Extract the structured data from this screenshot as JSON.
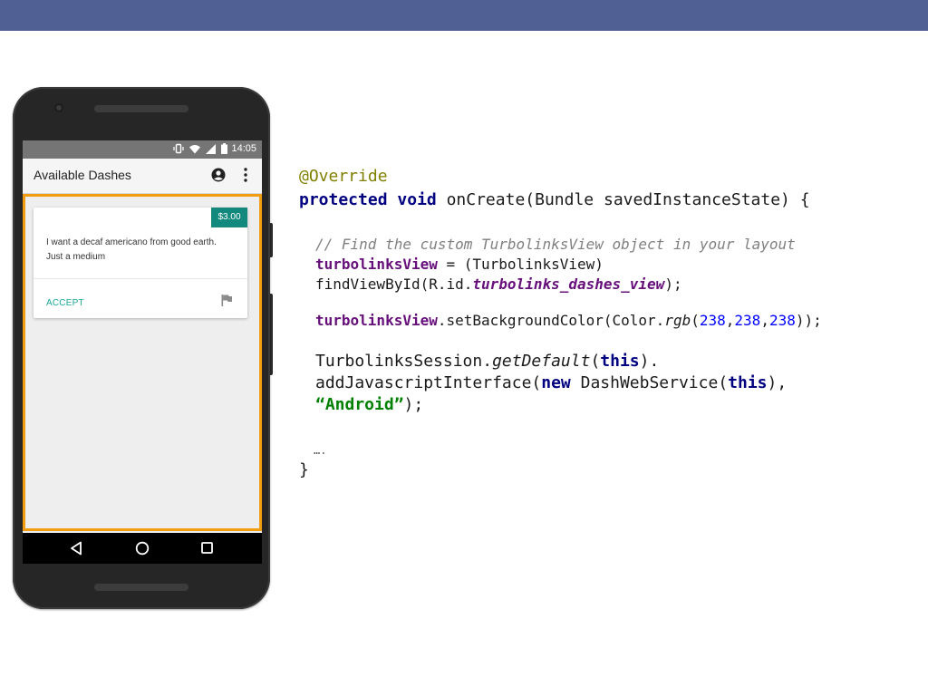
{
  "status_bar": {
    "time": "14:05"
  },
  "app_bar": {
    "title": "Available Dashes"
  },
  "card": {
    "price": "$3.00",
    "text": "I want a decaf americano from good earth. Just a medium",
    "accept_label": "ACCEPT"
  },
  "colors": {
    "slide_bar": "#505f94",
    "webview_highlight": "#f29c0f",
    "price_badge": "#13897d",
    "accept_link": "#19a697"
  },
  "icons": [
    "vibrate-icon",
    "wifi-icon",
    "signal-icon",
    "battery-icon",
    "account-icon",
    "more-vert-icon",
    "flag-icon",
    "back-icon",
    "home-icon",
    "recent-apps-icon"
  ],
  "code": {
    "annotation": "@Override",
    "kw_protected": "protected",
    "kw_void": "void",
    "signature": " onCreate(Bundle savedInstanceState) {",
    "comment": "// Find the custom TurbolinksView object in your layout",
    "field_turbolinks_view": "turbolinksView",
    "assign_cast": " = (TurbolinksView)",
    "find_view_prefix": "findViewById(R.id.",
    "view_id": "turbolinks_dashes_view",
    "find_view_suffix": ");",
    "set_bg_call": ".setBackgroundColor(Color.",
    "rgb_method": "rgb",
    "paren_open": "(",
    "r": "238",
    "g": "238",
    "b": "238",
    "comma": ",",
    "close_bg": "));",
    "session_class": "TurbolinksSession.",
    "get_default": "getDefault",
    "kw_this": "this",
    "close_dot": ").",
    "add_js_call": "addJavascriptInterface(",
    "kw_new": "new",
    "dash_web_service": " DashWebService(",
    "close_comma": "),",
    "string_android": "“Android”",
    "close_stmt": ");",
    "ellipsis": "….",
    "closing_brace": "}"
  }
}
